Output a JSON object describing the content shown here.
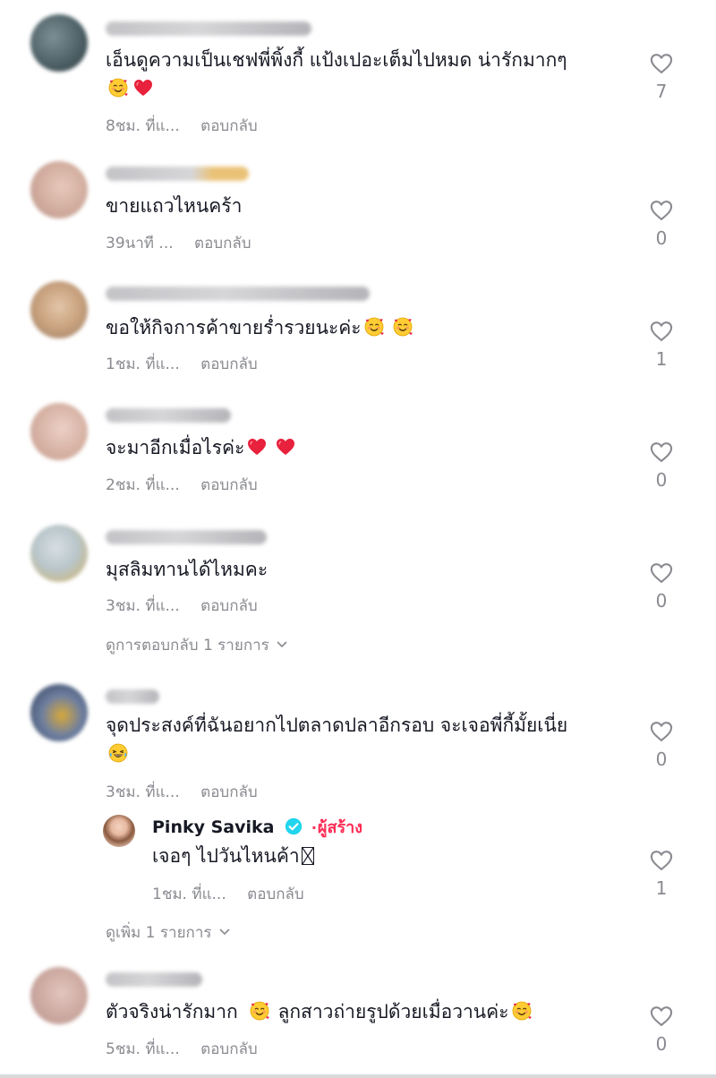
{
  "comments": [
    {
      "text": "เอ็นดูความเป็นเชฟพี่พิ้งกี้ แป้งเปอะเต็มไปหมด น่ารักมากๆ",
      "time": "8ชม. ที่แ...",
      "reply": "ตอบกลับ",
      "likes": "7"
    },
    {
      "text": "ขายแถวไหนคร้า",
      "time": "39นาที ...",
      "reply": "ตอบกลับ",
      "likes": "0"
    },
    {
      "text": "ขอให้กิจการค้าขายร่ำรวยนะค่ะ",
      "time": "1ชม. ที่แ...",
      "reply": "ตอบกลับ",
      "likes": "1"
    },
    {
      "text": "จะมาอีกเมื่อไรค่ะ",
      "time": "2ชม. ที่แ...",
      "reply": "ตอบกลับ",
      "likes": "0"
    },
    {
      "text": "มุสลิมทานได้ไหมคะ",
      "time": "3ชม. ที่แ...",
      "reply": "ตอบกลับ",
      "likes": "0",
      "view_replies": "ดูการตอบกลับ 1 รายการ"
    },
    {
      "text": "จุดประสงค์ที่ฉันอยากไปตลาดปลาอีกรอบ จะเจอพี่กี้มั้ยเนี่ย",
      "time": "3ชม. ที่แ...",
      "reply": "ตอบกลับ",
      "likes": "0",
      "creator_reply": {
        "name": "Pinky Savika",
        "badge": "ผู้สร้าง",
        "text": "เจอๆ ไปวันไหนค้า",
        "time": "1ชม. ที่แ...",
        "reply": "ตอบกลับ",
        "likes": "1"
      },
      "view_more": "ดูเพิ่ม 1 รายการ"
    },
    {
      "text_a": "ตัวจริงน่ารักมาก",
      "text_b": "ลูกสาวถ่ายรูปด้วยเมื่อวานค่ะ",
      "time": "5ชม. ที่แ...",
      "reply": "ตอบกลับ",
      "likes": "0"
    }
  ],
  "colors": {
    "text": "#161823",
    "muted": "#8a8b91",
    "creator_accent": "#fe2c55",
    "verified": "#20d5ec",
    "heart_emoji": "#e8213c"
  },
  "icons": {
    "like": "heart-outline-icon",
    "verified": "verified-badge-icon",
    "expand": "chevron-down-icon"
  }
}
